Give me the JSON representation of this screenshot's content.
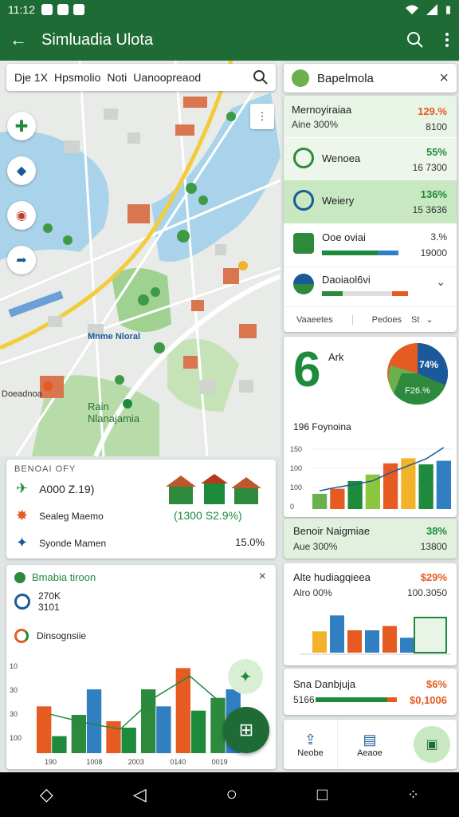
{
  "status": {
    "time": "11:12"
  },
  "appbar": {
    "title": "Simluadia Ulota"
  },
  "search": {
    "text_a": "Dje 1X",
    "text_b": "Hpsmolio",
    "text_c": "Noti",
    "text_d": "Uanoopreaod"
  },
  "map": {
    "label_district": "Mnme Nloral",
    "label_park": "Rain Nlanajamia",
    "label_left": "Doeadnoa",
    "panel": {
      "header": "BENOAI OFY",
      "row1": "A000 Z.19)",
      "row2": "Sealeg Maemo",
      "row3": "Syonde Mamen",
      "row3_val": "15.0%",
      "badge": "(1300 S2.9%)"
    }
  },
  "legend_card": {
    "title": "Bmabia tiroon",
    "value1": "270K",
    "value2": "3101",
    "subtitle": "Dinsognsiie",
    "close": "×"
  },
  "left_chart": {
    "chart_data": {
      "type": "bar",
      "categories": [
        "190",
        "1008",
        "2003",
        "0140",
        "0019"
      ],
      "y_ticks": [
        "100",
        "30",
        "30",
        "10"
      ],
      "series": [
        {
          "values": [
            8,
            30,
            12,
            22,
            20,
            30
          ]
        },
        {
          "values": [
            22,
            18,
            15,
            30,
            40,
            26
          ]
        }
      ]
    }
  },
  "panel_header": {
    "title": "Bapelmola",
    "close": "×"
  },
  "metrics": [
    {
      "label": "Mernoyiraiaa",
      "sub": "Aine 300%",
      "value": "129.%",
      "value2": "8100"
    },
    {
      "label": "Wenoea",
      "value": "55%",
      "value2": "16 7300"
    },
    {
      "label": "Weiery",
      "value": "136%",
      "value2": "15 3636"
    },
    {
      "label": "Ooe oviai",
      "value": "3.%",
      "value2": "19000"
    },
    {
      "label": "Daoiaol6vi"
    }
  ],
  "metric_footer": {
    "left": "Vaaeetes",
    "mid": "Pedoes",
    "right": "St"
  },
  "donut_card": {
    "big": "6",
    "big_label": "Ark",
    "pct_a": "74%",
    "pct_b": "F26.%",
    "subtitle": "196 Foynoina",
    "chart_data": {
      "type": "bar",
      "categories": [
        "",
        "",
        "",
        "",
        "",
        "",
        "",
        ""
      ],
      "y_ticks": [
        "150",
        "100",
        "100",
        "0"
      ],
      "values": [
        30,
        40,
        55,
        68,
        90,
        100,
        88,
        95
      ],
      "line": [
        40,
        48,
        54,
        62,
        80,
        95,
        110,
        135
      ]
    }
  },
  "section2": {
    "title": "Benoir Naigmiae",
    "sub": "Aue 300%",
    "value": "38%",
    "value2": "13800"
  },
  "section3": {
    "title": "Alte hudiagqieea",
    "sub": "Alro 00%",
    "value": "$29%",
    "value2": "100.3050",
    "chart_data": {
      "type": "bar",
      "values": [
        40,
        70,
        42,
        42,
        50,
        28
      ]
    }
  },
  "section4": {
    "title": "Sna Danbjuja",
    "sub": "5166",
    "value": "$6%",
    "value2": "$0,1006"
  },
  "bottom_actions": {
    "a": "Neobe",
    "b": "Aeaoe"
  }
}
